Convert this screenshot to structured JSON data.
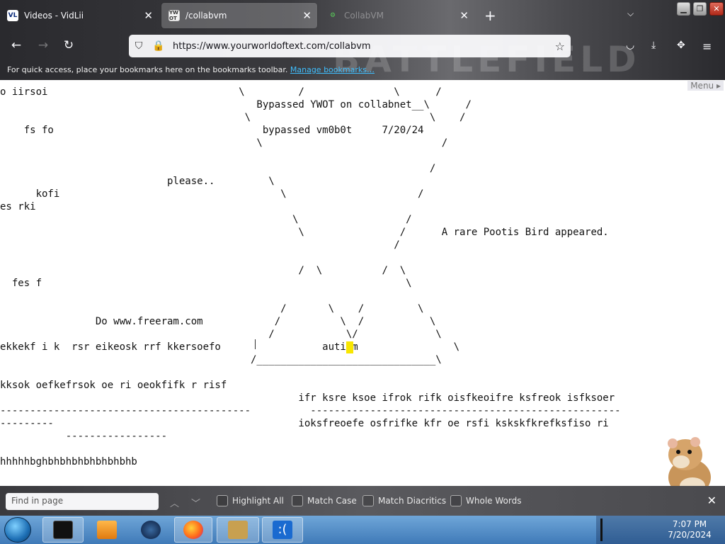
{
  "browser": {
    "background_art_text": "BATTLEFIELD",
    "tabs": [
      {
        "title": "Videos - VidLii",
        "favicon": "VL"
      },
      {
        "title": "/collabvm",
        "favicon": "YW OT"
      },
      {
        "title": "CollabVM",
        "favicon": ""
      }
    ],
    "url": "https://www.yourworldoftext.com/collabvm",
    "bookmarks_hint": "For quick access, place your bookmarks here on the bookmarks toolbar.",
    "bookmarks_link": "Manage bookmarks…"
  },
  "page": {
    "menu_label": "Menu",
    "lines": [
      "o iirsoi                                \\         /               \\      /",
      "                                           Bypassed YWOT on collabnet__\\      /",
      "                                         \\                              \\    /",
      "    fs fo                                   bypassed vm0b0t     7/20/24",
      "                                           \\                              /",
      "",
      "                                                                        /",
      "                            please..         \\",
      "      kofi                                     \\                      /",
      "es rki",
      "                                                 \\                  /",
      "                                                  \\                /      A rare Pootis Bird appeared.",
      "                                                                  /",
      "",
      "                                                  /  \\          /  \\",
      "  fes f                                                             \\",
      "",
      "                                               /       \\    /         \\",
      "                Do www.freeram.com            /          \\  /           \\",
      "                                             /            \\/             \\",
      "ekkekf i k  rsr eikeosk rrf kkersoefo                 autism                \\",
      "                                          /______________________________\\",
      "",
      "kksok oefkefrsok oe ri oeokfifk r risf",
      "                                                  ifr ksre ksoe ifrok rifk oisfkeoifre ksfreok isfksoer",
      "------------------------------------------          ----------------------------------------------------",
      "---------                                         ioksfreoefe osfrifke kfr oe rsfi kskskfkrefksfiso ri",
      "           -----------------",
      "",
      "hhhhhbghbhbhbhbhbhbhbhb"
    ]
  },
  "findbar": {
    "placeholder": "Find in page",
    "highlight_all": "Highlight All",
    "match_case": "Match Case",
    "match_diacritics": "Match Diacritics",
    "whole_words": "Whole Words"
  },
  "taskbar": {
    "time": "7:07 PM",
    "date": "7/20/2024",
    "apps": [
      "terminal",
      "media-player",
      "network",
      "firefox",
      "box",
      "sad-face"
    ]
  },
  "colors": {
    "cursor": "#f8e600",
    "taskbar_top": "#6fa6d8",
    "taskbar_bottom": "#3f7ab8"
  }
}
